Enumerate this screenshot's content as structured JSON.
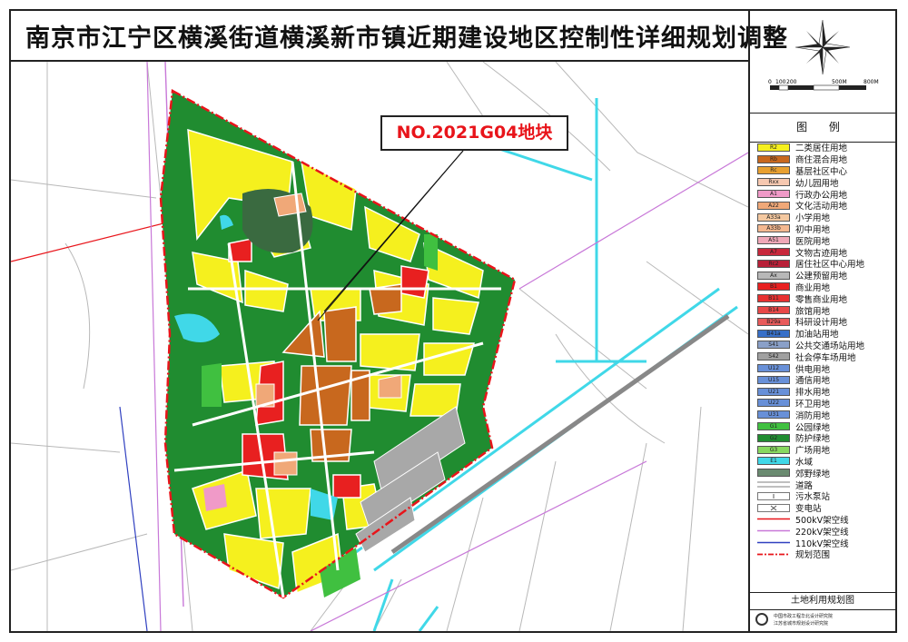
{
  "title": "南京市江宁区横溪街道横溪新市镇近期建设地区控制性详细规划调整",
  "callout": "NO.2021G04地块",
  "scale": {
    "ticks": [
      "0",
      "100",
      "200",
      "500M",
      "800M"
    ]
  },
  "legend_title": "图 例",
  "legend": [
    {
      "code": "R2",
      "label": "二类居住用地",
      "color": "#f5f01e"
    },
    {
      "code": "Rb",
      "label": "商住混合用地",
      "color": "#c8681e"
    },
    {
      "code": "Rc",
      "label": "基层社区中心",
      "color": "#e8a030"
    },
    {
      "code": "Rxx",
      "label": "幼儿园用地",
      "color": "#f6c8b0"
    },
    {
      "code": "A1",
      "label": "行政办公用地",
      "color": "#f09ac8"
    },
    {
      "code": "A22",
      "label": "文化活动用地",
      "color": "#f0a878"
    },
    {
      "code": "A33a",
      "label": "小学用地",
      "color": "#f4c8a0"
    },
    {
      "code": "A33b",
      "label": "初中用地",
      "color": "#f4b890"
    },
    {
      "code": "A51",
      "label": "医院用地",
      "color": "#f0a8b8"
    },
    {
      "code": "A7",
      "label": "文物古迹用地",
      "color": "#c8283c"
    },
    {
      "code": "Rc2",
      "label": "居住社区中心用地",
      "color": "#b82038"
    },
    {
      "code": "Ax",
      "label": "公建预留用地",
      "color": "#b8b8b8"
    },
    {
      "code": "B1",
      "label": "商业用地",
      "color": "#e82020"
    },
    {
      "code": "B11",
      "label": "零售商业用地",
      "color": "#e83030"
    },
    {
      "code": "B14",
      "label": "旅馆用地",
      "color": "#e84848"
    },
    {
      "code": "B29a",
      "label": "科研设计用地",
      "color": "#e85a5a"
    },
    {
      "code": "B41a",
      "label": "加油站用地",
      "color": "#3870c8"
    },
    {
      "code": "S41",
      "label": "公共交通场站用地",
      "color": "#8aa0c8"
    },
    {
      "code": "S42",
      "label": "社会停车场用地",
      "color": "#a0a0a0"
    },
    {
      "code": "U12",
      "label": "供电用地",
      "color": "#6890d8"
    },
    {
      "code": "U15",
      "label": "通信用地",
      "color": "#6890d8"
    },
    {
      "code": "U21",
      "label": "排水用地",
      "color": "#6890d8"
    },
    {
      "code": "U22",
      "label": "环卫用地",
      "color": "#6890d8"
    },
    {
      "code": "U31",
      "label": "消防用地",
      "color": "#6890d8"
    },
    {
      "code": "G1",
      "label": "公园绿地",
      "color": "#40c040"
    },
    {
      "code": "G2",
      "label": "防护绿地",
      "color": "#208c30"
    },
    {
      "code": "G3",
      "label": "广场用地",
      "color": "#88d860"
    },
    {
      "code": "E1",
      "label": "水域",
      "color": "#40d8e8"
    },
    {
      "code": "",
      "label": "郊野绿地",
      "color": "#6a8a70"
    },
    {
      "code": "",
      "label": "道路",
      "color": "line-road"
    },
    {
      "code": "",
      "label": "污水泵站",
      "color": "line-pump"
    },
    {
      "code": "",
      "label": "变电站",
      "color": "line-sub"
    },
    {
      "code": "",
      "label": "500kV架空线",
      "color": "line-500"
    },
    {
      "code": "",
      "label": "220kV架空线",
      "color": "line-220"
    },
    {
      "code": "",
      "label": "110kV架空线",
      "color": "line-110"
    },
    {
      "code": "",
      "label": "规划范围",
      "color": "line-boundary"
    }
  ],
  "footer_name": "土地利用规划图",
  "org": {
    "line1": "中国市政工程华北设计研究院",
    "line2": "江苏省城市规划设计研究院"
  },
  "colors": {
    "residential": "#f5f01e",
    "mixed": "#c8681e",
    "commercial": "#e82020",
    "green_park": "#40c040",
    "green_buffer": "#208c30",
    "water": "#40d8e8",
    "storage": "#a8a8a8",
    "boundary": "#e8141a",
    "line_500kv": "#e8141a",
    "line_220kv": "#c878d8",
    "line_110kv": "#3040c0"
  }
}
